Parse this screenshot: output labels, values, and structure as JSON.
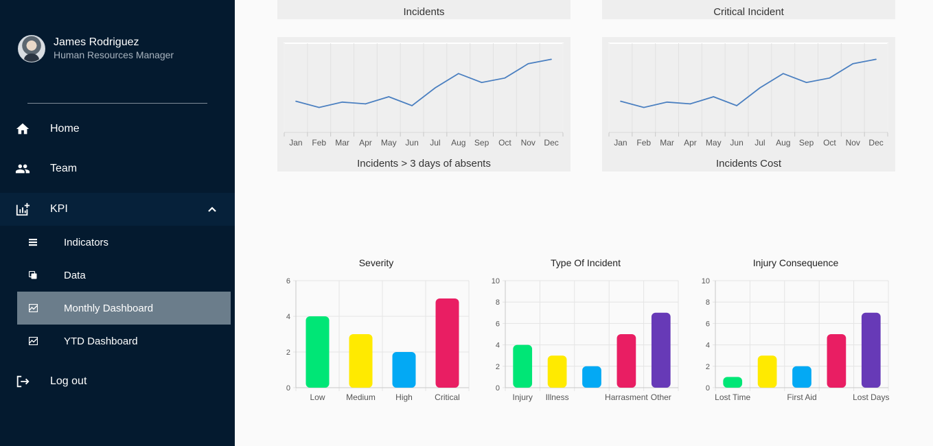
{
  "user": {
    "name": "James Rodriguez",
    "role": "Human Resources Manager"
  },
  "nav": {
    "home": "Home",
    "team": "Team",
    "kpi": "KPI",
    "indicators": "Indicators",
    "data": "Data",
    "monthly": "Monthly Dashboard",
    "ytd": "YTD Dashboard",
    "logout": "Log out"
  },
  "tabs": {
    "left": "Incidents",
    "right": "Critical Incident"
  },
  "line_cards": {
    "left_title": "Incidents > 3 days of absents",
    "right_title": "Incidents Cost"
  },
  "chart_data": [
    {
      "type": "line",
      "title": "Incidents > 3 days of absents",
      "categories": [
        "Jan",
        "Feb",
        "Mar",
        "Apr",
        "May",
        "Jun",
        "Jul",
        "Aug",
        "Sep",
        "Oct",
        "Nov",
        "Dec"
      ],
      "series": [
        {
          "values": [
            3.5,
            2.8,
            3.4,
            3.2,
            4.0,
            3.0,
            5.0,
            6.6,
            5.6,
            6.1,
            7.7,
            8.2
          ]
        }
      ],
      "ylim": [
        0,
        10
      ],
      "color": "#4a7fc0",
      "grid": true
    },
    {
      "type": "line",
      "title": "Incidents Cost",
      "categories": [
        "Jan",
        "Feb",
        "Mar",
        "Apr",
        "May",
        "Jun",
        "Jul",
        "Aug",
        "Sep",
        "Oct",
        "Nov",
        "Dec"
      ],
      "series": [
        {
          "values": [
            3.5,
            2.8,
            3.4,
            3.2,
            4.0,
            3.0,
            5.0,
            6.6,
            5.6,
            6.1,
            7.7,
            8.2
          ]
        }
      ],
      "ylim": [
        0,
        10
      ],
      "color": "#4a7fc0",
      "grid": true
    },
    {
      "type": "bar",
      "title": "Severity",
      "categories": [
        "Low",
        "Medium",
        "High",
        "Critical"
      ],
      "values": [
        4,
        3,
        2,
        5
      ],
      "colors": [
        "#00e676",
        "#ffea00",
        "#03a9f4",
        "#e91e63"
      ],
      "ylim": [
        0,
        6
      ],
      "yticks": [
        0,
        2,
        4,
        6
      ]
    },
    {
      "type": "bar",
      "title": "Type Of Incident",
      "categories": [
        "Injury",
        "Illness",
        "",
        "Harrasment",
        "Other"
      ],
      "values": [
        4,
        3,
        2,
        5,
        7
      ],
      "colors": [
        "#00e676",
        "#ffea00",
        "#03a9f4",
        "#e91e63",
        "#673ab7"
      ],
      "ylim": [
        0,
        10
      ],
      "yticks": [
        0,
        2,
        4,
        6,
        8,
        10
      ]
    },
    {
      "type": "bar",
      "title": "Injury Consequence",
      "categories": [
        "Lost Time",
        "",
        "First Aid",
        "",
        "Lost Days"
      ],
      "values": [
        1,
        3,
        2,
        5,
        7
      ],
      "colors": [
        "#00e676",
        "#ffea00",
        "#03a9f4",
        "#e91e63",
        "#673ab7"
      ],
      "ylim": [
        0,
        10
      ],
      "yticks": [
        0,
        2,
        4,
        6,
        8,
        10
      ]
    }
  ]
}
